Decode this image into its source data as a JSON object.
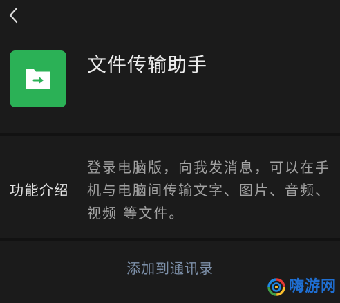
{
  "header": {
    "back_icon": "chevron-left-icon"
  },
  "profile": {
    "name": "文件传输助手",
    "avatar_icon": "folder-transfer-icon",
    "avatar_color": "#2bb156"
  },
  "intro": {
    "label": "功能介绍",
    "description_lines": [
      "登录电脑版，向我发消息，可以在手",
      "机与电脑间传输文字、图片、音频、",
      "视频 等文件。"
    ]
  },
  "actions": {
    "add_to_contacts": "添加到通讯录"
  },
  "watermark": {
    "logo_icon": "swirl-logo-icon",
    "text": "嗨游网"
  },
  "colors": {
    "background": "#1b1b1b",
    "primary_text": "#ececec",
    "secondary_text": "#a2a2a2",
    "link": "#7d90a9",
    "accent_green": "#2bb156",
    "watermark_blue": "#1f6fd2"
  }
}
